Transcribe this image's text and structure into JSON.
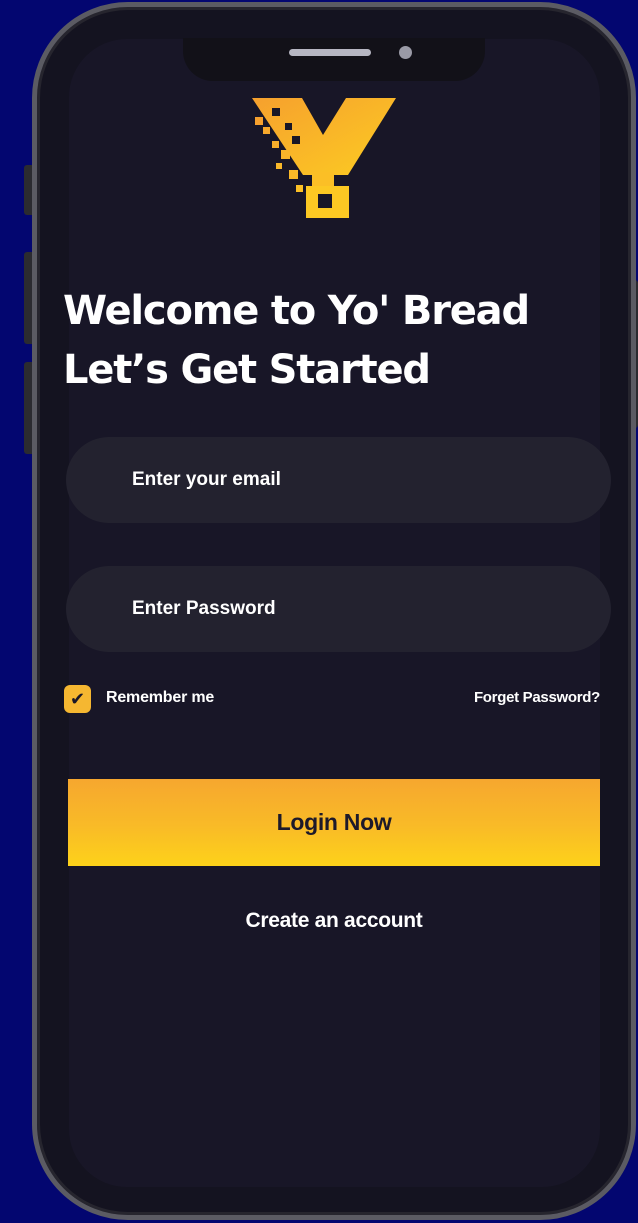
{
  "welcome": {
    "title": "Welcome to Yo' Bread Let’s Get Started"
  },
  "form": {
    "email_placeholder": "Enter your email",
    "password_placeholder": "Enter Password",
    "remember_label": "Remember me",
    "remember_checked": true,
    "forgot_label": "Forget Password?",
    "login_label": "Login Now",
    "create_label": "Create an account"
  },
  "icons": {
    "checkbox": "check-icon",
    "logo": "yo-bread-logo"
  },
  "colors": {
    "background": "#030670",
    "screen": "#181627",
    "field": "#23222f",
    "accent": "#f9bb27",
    "text": "#ffffff"
  }
}
